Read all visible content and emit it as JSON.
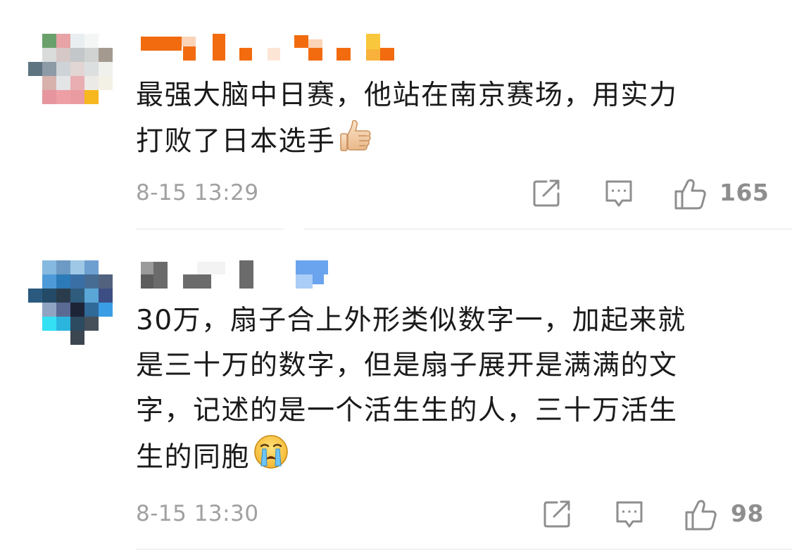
{
  "comments": [
    {
      "text_line1": "最强大脑中日赛，他站在南京赛场，用实力",
      "text_line2": "打败了日本选手",
      "emoji": "thumbs-up",
      "timestamp": "8-15 13:29",
      "like_count": "165"
    },
    {
      "text_line1": "30万，扇子合上外形类似数字一，加起来就",
      "text_line2": "是三十万的数字，但是扇子展开是满满的文",
      "text_line3": "字，记述的是一个活生生的人，三十万活生",
      "text_line4": "生的同胞",
      "emoji": "crying-face",
      "timestamp": "8-15 13:30",
      "like_count": "98"
    }
  ],
  "icons": {
    "share": "share-icon",
    "comment": "comment-icon",
    "like": "thumbs-up-icon"
  },
  "colors": {
    "timestamp": "#a0a0a0",
    "icon": "#8e8e8e",
    "divider": "#e6e6e6",
    "username_redacted_1": "#f26b0f",
    "username_redacted_2": "#6b6b6b"
  }
}
